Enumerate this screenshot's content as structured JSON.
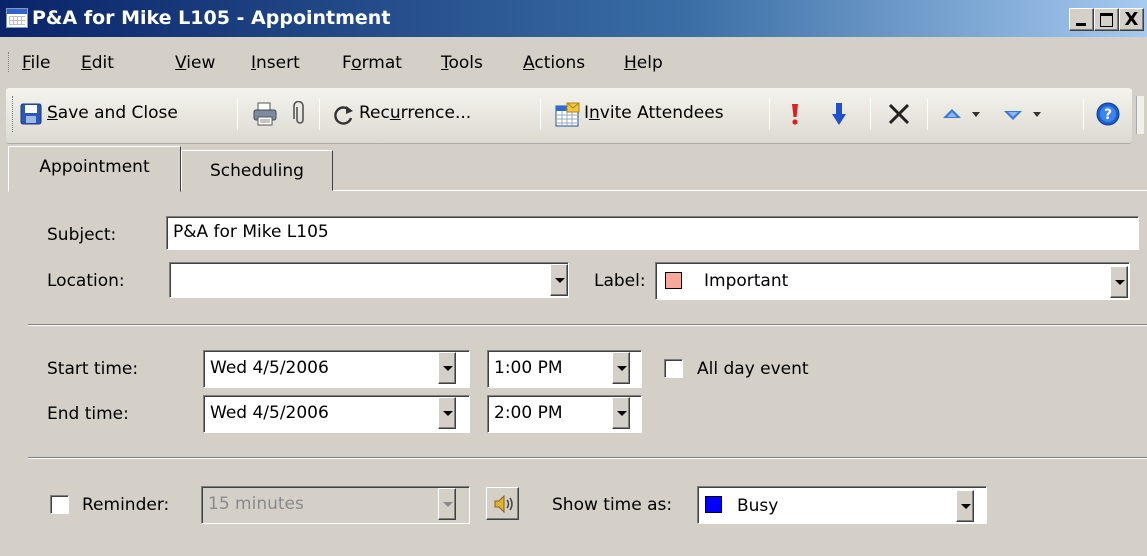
{
  "window": {
    "title": "P&A for Mike L105 - Appointment",
    "controls": {
      "minimize": "_",
      "maximize": "□",
      "close": "X"
    }
  },
  "menu": {
    "items": [
      {
        "label": "File",
        "accel": "F",
        "rest": "ile"
      },
      {
        "label": "Edit",
        "accel": "E",
        "rest": "dit"
      },
      {
        "label": "View",
        "accel": "V",
        "rest": "iew"
      },
      {
        "label": "Insert",
        "accel": "I",
        "rest": "nsert"
      },
      {
        "label": "Format",
        "pre": "F",
        "accel": "o",
        "rest": "rmat"
      },
      {
        "label": "Tools",
        "accel": "T",
        "rest": "ools"
      },
      {
        "label": "Actions",
        "accel": "A",
        "rest": "ctions"
      },
      {
        "label": "Help",
        "accel": "H",
        "rest": "elp"
      }
    ]
  },
  "toolbar": {
    "save_pre": "",
    "save_accel": "S",
    "save_rest": "ave and Close",
    "recurrence_pre": "Rec",
    "recurrence_accel": "u",
    "recurrence_rest": "rrence...",
    "invite_pre": "I",
    "invite_accel": "n",
    "invite_rest": "vite Attendees",
    "icons": [
      "save-icon",
      "print-icon",
      "paperclip-icon",
      "recurrence-icon",
      "invite-icon",
      "importance-high-icon",
      "importance-low-icon",
      "delete-icon",
      "previous-item-icon",
      "next-item-icon",
      "help-icon"
    ],
    "colors": {
      "importance_high": "#e02020",
      "importance_low": "#2050d0",
      "nav_arrow": "#3a78d8",
      "help": "#1a5fd0"
    }
  },
  "tabs": [
    {
      "label": "Appointment",
      "active": true
    },
    {
      "label": "Scheduling",
      "active": false
    }
  ],
  "form": {
    "subject_label": "Subject:",
    "subject_value": "P&A for Mike L105",
    "location_label": "Location:",
    "location_value": "",
    "label_label": "Label:",
    "label_value": "Important",
    "label_color": "#f7a89a",
    "start_label": "Start time:",
    "start_date": "Wed 4/5/2006",
    "start_time": "1:00 PM",
    "all_day_label": "All day event",
    "all_day_checked": false,
    "end_label": "End time:",
    "end_date": "Wed 4/5/2006",
    "end_time": "2:00 PM",
    "reminder_label": "Reminder:",
    "reminder_checked": false,
    "reminder_value": "15 minutes",
    "show_as_label": "Show time as:",
    "show_as_value": "Busy",
    "show_as_color": "#0000ff"
  }
}
